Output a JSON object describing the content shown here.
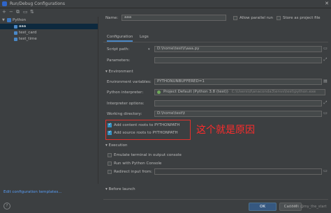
{
  "window": {
    "title": "Run/Debug Configurations",
    "close_glyph": "✕"
  },
  "tree": {
    "toolbar_icons": [
      "add-icon",
      "remove-icon",
      "copy-icon",
      "folder-icon",
      "sort-icon"
    ],
    "toolbar_glyphs": [
      "+",
      "−",
      "⧉",
      "▭",
      "⇅"
    ],
    "group": "Python",
    "items": [
      "aaa",
      "test_card",
      "test_time"
    ]
  },
  "footer": {
    "edit_templates": "Edit configuration templates...",
    "help": "?"
  },
  "name": {
    "label": "Name:",
    "value": "aaa"
  },
  "options": {
    "allow_parallel": "Allow parallel run",
    "store_project": "Store as project file"
  },
  "tabs": [
    "Configuration",
    "Logs"
  ],
  "config": {
    "script_path": {
      "label": "Script path:",
      "value": "D:\\home\\test\\t\\aaa.py"
    },
    "parameters": {
      "label": "Parameters:",
      "value": ""
    },
    "environment_section": "Environment",
    "env_vars": {
      "label": "Environment variables:",
      "value": "PYTHONUNBUFFERED=1"
    },
    "interpreter": {
      "label": "Python interpreter:",
      "value": "Project Default (Python 3.8 (test))",
      "path": "C:\\Users\\d\\anaconda3\\envs\\test\\python.exe"
    },
    "interpreter_options": {
      "label": "Interpreter options:",
      "value": ""
    },
    "working_dir": {
      "label": "Working directory:",
      "value": "D:\\home\\test\\t"
    },
    "add_content_roots": "Add content roots to PYTHONPATH",
    "add_source_roots": "Add source roots to PYTHONPATH",
    "execution_section": "Execution",
    "emulate_terminal": "Emulate terminal in output console",
    "run_console": "Run with Python Console",
    "redirect_input": "Redirect input from:",
    "before_launch_section": "Before launch"
  },
  "annotation": "这个就是原因",
  "buttons": {
    "ok": "OK",
    "cancel": "Cancel"
  },
  "watermark": "CSDN @my_the_start",
  "colors": {
    "accent": "#4a88c7",
    "annotation": "#e0312d",
    "selection": "#0d293e"
  }
}
